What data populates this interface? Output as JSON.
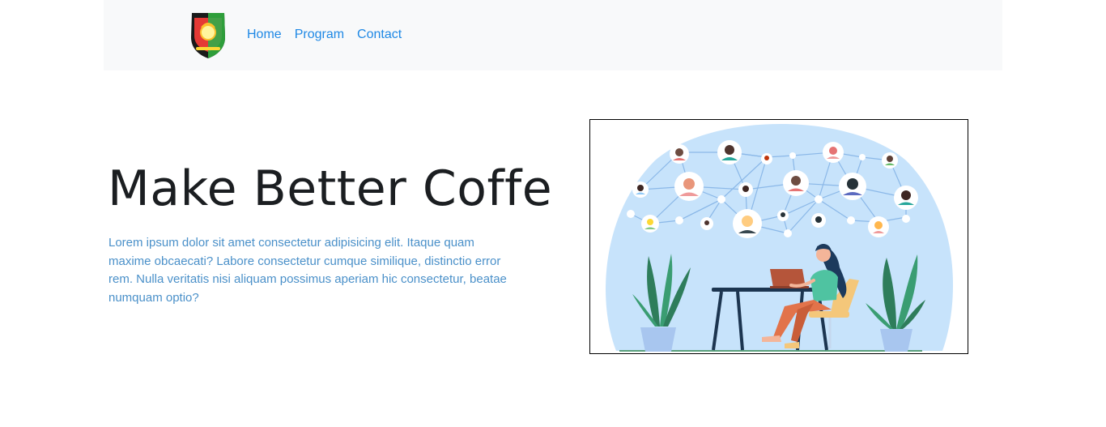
{
  "nav": {
    "logo_icon": "shield-emblem-logo",
    "links": [
      {
        "label": "Home"
      },
      {
        "label": "Program"
      },
      {
        "label": "Contact"
      }
    ],
    "link_color": "#1e88e5",
    "background": "#f8f9fa"
  },
  "hero": {
    "title": "Make Better Coffe",
    "body": "Lorem ipsum dolor sit amet consectetur adipisicing elit. Itaque quam maxime obcaecati? Labore consectetur cumque similique, distinctio error rem. Nulla veritatis nisi aliquam possimus aperiam hic consectetur, beatae numquam optio?",
    "body_color": "#4a90c9"
  },
  "illustration": {
    "icon": "remote-work-network-illustration",
    "blob_color": "#c7e3fb"
  }
}
